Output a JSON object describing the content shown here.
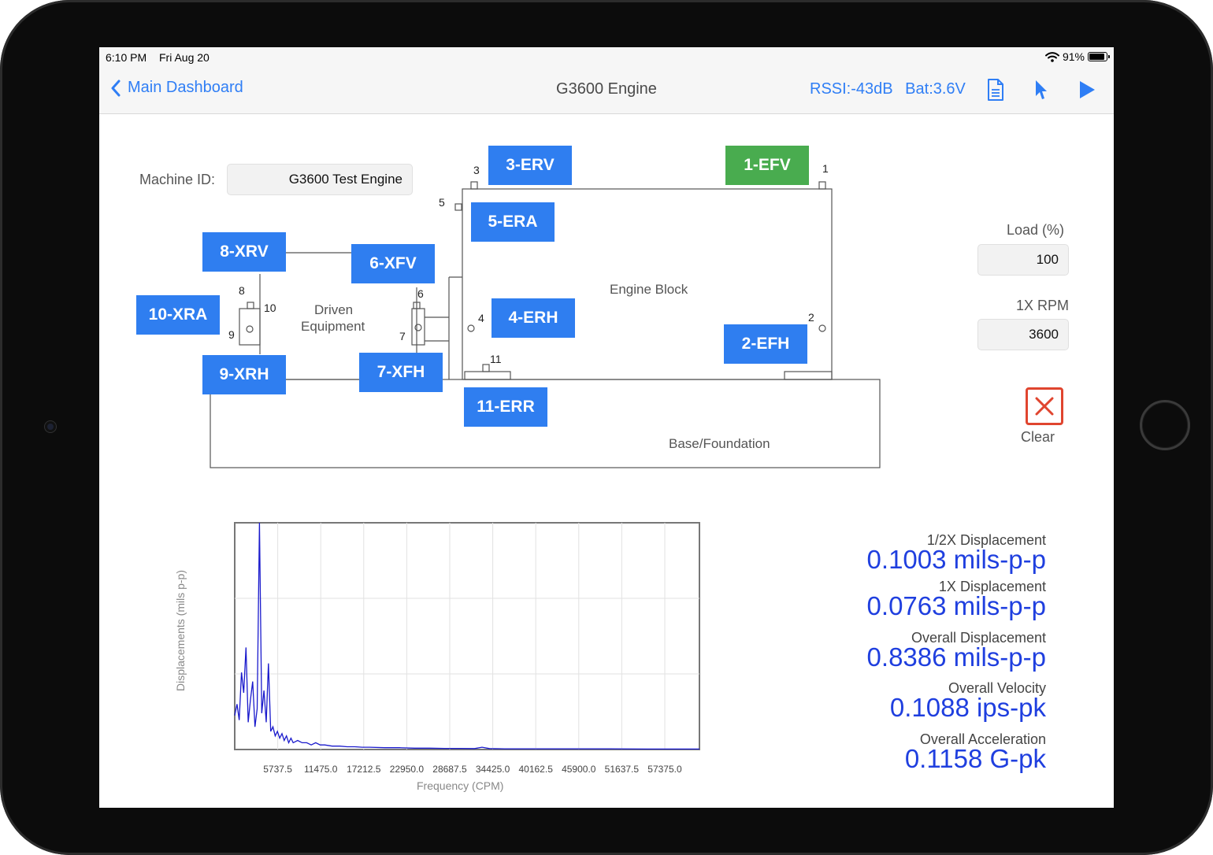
{
  "status_bar": {
    "time": "6:10 PM",
    "date": "Fri Aug 20",
    "battery": "91%",
    "battery_level": 0.91
  },
  "nav": {
    "back_label": "Main Dashboard",
    "title": "G3600 Engine",
    "rssi": "RSSI:-43dB",
    "battery_voltage": "Bat:3.6V",
    "icons": [
      "document-icon",
      "cursor-icon",
      "play-icon"
    ]
  },
  "machine": {
    "id_label": "Machine ID:",
    "id_value": "G3600 Test Engine"
  },
  "diagram": {
    "engine_block": "Engine Block",
    "driven_equipment_line1": "Driven",
    "driven_equipment_line2": "Equipment",
    "base": "Base/Foundation",
    "point_numbers": {
      "p1": "1",
      "p2": "2",
      "p3": "3",
      "p4": "4",
      "p5": "5",
      "p6": "6",
      "p7": "7",
      "p8": "8",
      "p9": "9",
      "p10": "10",
      "p11": "11"
    },
    "sensors": {
      "s1": "1-EFV",
      "s2": "2-EFH",
      "s3": "3-ERV",
      "s4": "4-ERH",
      "s5": "5-ERA",
      "s6": "6-XFV",
      "s7": "7-XFH",
      "s8": "8-XRV",
      "s9": "9-XRH",
      "s10": "10-XRA",
      "s11": "11-ERR"
    },
    "active_sensor": "1-EFV"
  },
  "settings": {
    "load_label": "Load (%)",
    "load_value": "100",
    "rpm_label": "1X RPM",
    "rpm_value": "3600",
    "clear_label": "Clear"
  },
  "readouts": {
    "half_x_label": "1/2X Displacement",
    "half_x_value": "0.1003 mils-p-p",
    "one_x_label": "1X Displacement",
    "one_x_value": "0.0763 mils-p-p",
    "overall_disp_label": "Overall Displacement",
    "overall_disp_value": "0.8386 mils-p-p",
    "overall_vel_label": "Overall Velocity",
    "overall_vel_value": "0.1088 ips-pk",
    "overall_acc_label": "Overall Acceleration",
    "overall_acc_value": "0.1158 G-pk"
  },
  "chart_data": {
    "type": "line",
    "xlabel": "Frequency (CPM)",
    "ylabel": "Displacements (mils p-p)",
    "xlim": [
      0,
      62000
    ],
    "ylim": [
      0,
      1.0
    ],
    "x_tick_labels": [
      "5737.5",
      "11475.0",
      "17212.5",
      "22950.0",
      "28687.5",
      "34425.0",
      "40162.5",
      "45900.0",
      "51637.5",
      "57375.0"
    ],
    "x_ticks": [
      5737.5,
      11475.0,
      17212.5,
      22950.0,
      28687.5,
      34425.0,
      40162.5,
      45900.0,
      51637.5,
      57375.0
    ],
    "grid": true,
    "series": [
      {
        "color": "#1a1acc",
        "x": [
          0,
          300,
          600,
          900,
          1200,
          1500,
          1800,
          2100,
          2400,
          2700,
          3000,
          3300,
          3600,
          3900,
          4200,
          4500,
          4800,
          5100,
          5400,
          5700,
          6000,
          6300,
          6600,
          6900,
          7200,
          7500,
          7800,
          8400,
          9000,
          9600,
          10200,
          10800,
          11400,
          12000,
          13000,
          14000,
          15000,
          16000,
          17000,
          18000,
          20000,
          22000,
          24000,
          26000,
          28000,
          30000,
          32000,
          33000,
          34000,
          36000,
          40000,
          45000,
          50000,
          55000,
          60000,
          62000
        ],
        "y": [
          0.15,
          0.2,
          0.13,
          0.34,
          0.25,
          0.45,
          0.12,
          0.22,
          0.3,
          0.1,
          0.18,
          1.0,
          0.16,
          0.26,
          0.12,
          0.38,
          0.08,
          0.1,
          0.06,
          0.08,
          0.05,
          0.07,
          0.04,
          0.06,
          0.03,
          0.05,
          0.03,
          0.04,
          0.03,
          0.03,
          0.02,
          0.03,
          0.02,
          0.02,
          0.015,
          0.015,
          0.012,
          0.012,
          0.01,
          0.01,
          0.008,
          0.008,
          0.006,
          0.006,
          0.005,
          0.005,
          0.004,
          0.01,
          0.004,
          0.003,
          0.003,
          0.003,
          0.003,
          0.002,
          0.002,
          0.002
        ]
      }
    ]
  }
}
